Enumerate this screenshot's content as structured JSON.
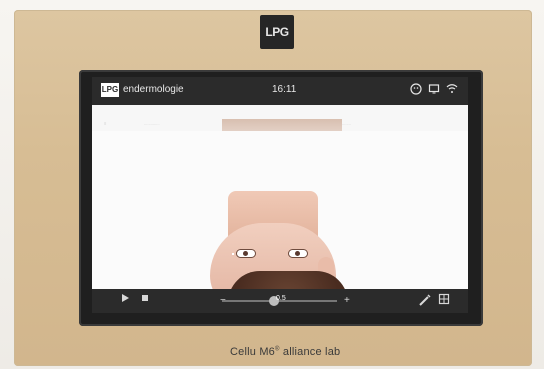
{
  "device": {
    "logo_text": "LPG",
    "label_main": "Cellu M6",
    "label_sup": "®",
    "label_tail": " alliance lab"
  },
  "app": {
    "logo_text": "LPG",
    "title": "endermologie",
    "time": "16:11",
    "status_icons": [
      "face-icon",
      "screen-icon",
      "wifi-icon"
    ]
  },
  "player": {
    "speed": "0.5",
    "minus": "−",
    "plus": "+",
    "progress_fraction": 0.45
  },
  "colors": {
    "device_body": "#d7bd94",
    "bar": "#2b2b2b"
  }
}
